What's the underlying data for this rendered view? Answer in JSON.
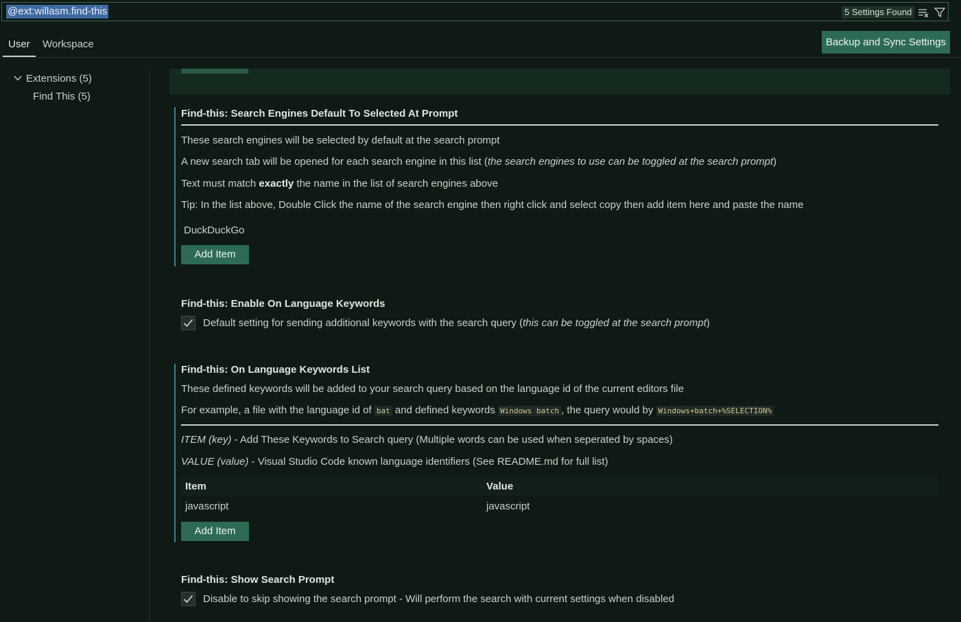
{
  "search": {
    "query": "@ext:willasm.find-this",
    "results_badge": "5 Settings Found",
    "clear_icon": "clear-filter-icon",
    "filter_icon": "filter-icon"
  },
  "tabs": [
    {
      "label": "User",
      "active": true
    },
    {
      "label": "Workspace",
      "active": false
    }
  ],
  "sync_button": "Backup and Sync Settings",
  "toc": {
    "extensions": "Extensions (5)",
    "find_this": "Find This (5)"
  },
  "settings": {
    "search_engines_default": {
      "title": "Find-this: Search Engines Default To Selected At Prompt",
      "desc1": "These search engines will be selected by default at the search prompt",
      "desc2_a": "A new search tab will be opened for each search engine in this list (",
      "desc2_em": "the search engines to use can be toggled at the search prompt",
      "desc2_b": ")",
      "desc3_a": "Text must match ",
      "desc3_b": "exactly",
      "desc3_c": " the name in the list of search engines above",
      "desc4": "Tip: In the list above, Double Click the name of the search engine then right click and select copy then add item here and paste the name",
      "items": [
        "DuckDuckGo"
      ],
      "add_item": "Add Item"
    },
    "enable_keywords": {
      "title": "Find-this: Enable On Language Keywords",
      "checked": true,
      "label_a": "Default setting for sending additional keywords with the search query (",
      "label_em": "this can be toggled at the search prompt",
      "label_b": ")"
    },
    "keywords_list": {
      "title": "Find-this: On Language Keywords List",
      "desc1": "These defined keywords will be added to your search query based on the language id of the current editors file",
      "desc2_a": "For example, a file with the language id of ",
      "code1": "bat",
      "desc2_b": " and defined keywords ",
      "code2": "Windows batch",
      "desc2_c": ", the query would by ",
      "code3": "Windows+batch+%SELECTION%",
      "item_em": "ITEM (key)",
      "item_desc": " - Add These Keywords to Search query (Multiple words can be used when seperated by spaces)",
      "value_em": "VALUE (value)",
      "value_desc": " - Visual Studio Code known language identifiers (See README.md for full list)",
      "columns": [
        "Item",
        "Value"
      ],
      "rows": [
        [
          "javascript",
          "javascript"
        ]
      ],
      "add_item": "Add Item"
    },
    "show_prompt": {
      "title": "Find-this: Show Search Prompt",
      "checked": true,
      "label": "Disable to skip showing the search prompt - Will perform the search with current settings when disabled"
    }
  }
}
